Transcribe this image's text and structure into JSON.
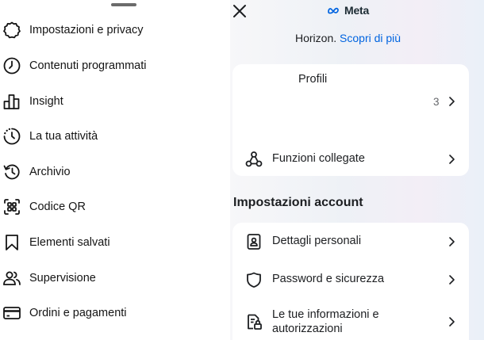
{
  "left_menu": {
    "items": [
      {
        "label": "Impostazioni e privacy",
        "icon": "gear-icon"
      },
      {
        "label": "Contenuti programmati",
        "icon": "clock-icon"
      },
      {
        "label": "Insight",
        "icon": "bar-chart-icon"
      },
      {
        "label": "La tua attività",
        "icon": "activity-icon"
      },
      {
        "label": "Archivio",
        "icon": "archive-icon"
      },
      {
        "label": "Codice QR",
        "icon": "qr-code-icon"
      },
      {
        "label": "Elementi salvati",
        "icon": "bookmark-icon"
      },
      {
        "label": "Supervisione",
        "icon": "supervision-icon"
      },
      {
        "label": "Ordini e pagamenti",
        "icon": "credit-card-icon"
      }
    ]
  },
  "accounts_center": {
    "close_icon": "close-icon",
    "logo_text": "Meta",
    "horizon_text": "Horizon.",
    "learn_more": "Scopri di più",
    "profiles": {
      "title": "Profili",
      "count": "3"
    },
    "connected_features": {
      "label": "Funzioni collegate",
      "icon": "connected-features-icon"
    },
    "account_settings": {
      "title": "Impostazioni account",
      "items": [
        {
          "label": "Dettagli personali",
          "icon": "id-card-icon"
        },
        {
          "label": "Password e sicurezza",
          "icon": "shield-icon"
        },
        {
          "label": "Le tue informazioni e autorizzazioni",
          "label_line1": "Le tue informazioni e",
          "label_line2": "autorizzazioni",
          "icon": "info-permissions-icon"
        }
      ]
    }
  },
  "colors": {
    "link": "#0064e0",
    "text": "#1c1e21",
    "secondary_text": "#65676b"
  }
}
